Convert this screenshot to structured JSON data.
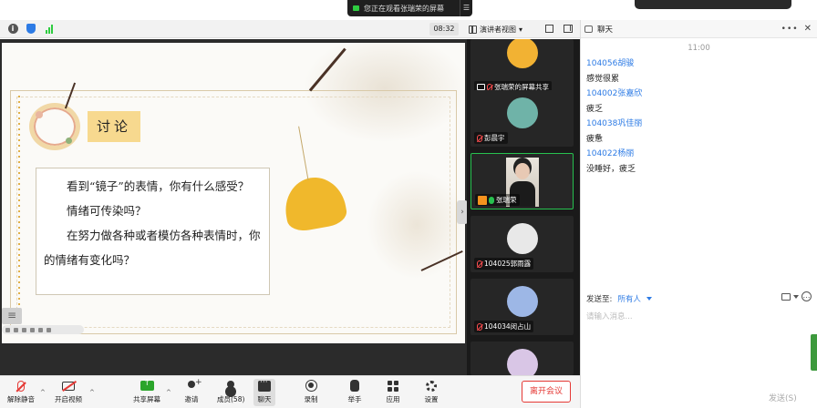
{
  "banner": {
    "text": "您正在观看张瑞荣的屏幕"
  },
  "topbar": {
    "timer": "08:32",
    "view_label": "演讲者视图"
  },
  "slide": {
    "title": "讨论",
    "paragraph1": "看到“镜子”的表情，你有什么感受？",
    "paragraph2": "情绪可传染吗？",
    "paragraph3": "在努力做各种或者模仿各种表情时，你的情绪有变化吗？"
  },
  "gallery": {
    "tiles": [
      {
        "name": "张瑞荣的屏幕共享",
        "avatar_color": "#f2b233"
      },
      {
        "name": "彭晨宇",
        "avatar_color": "#6fb3a8"
      },
      {
        "name": "张瑞荣"
      },
      {
        "name": "104025郭雨露",
        "avatar_color": "#e8e8e8"
      },
      {
        "name": "104034闵占山",
        "avatar_color": "#9db7e6"
      },
      {
        "name": "",
        "avatar_color": "#d9c6e6"
      }
    ]
  },
  "chat": {
    "title": "聊天",
    "time": "11:00",
    "messages": [
      {
        "sender": "104056胡骏",
        "text": "感觉很累"
      },
      {
        "sender": "104002张嘉欣",
        "text": "疲乏"
      },
      {
        "sender": "104038巩佳丽",
        "text": "疲惫"
      },
      {
        "sender": "104022杨丽",
        "text": "没睡好，疲乏"
      }
    ],
    "send_to_label": "发送至:",
    "send_to_value": "所有人",
    "input_placeholder": "请输入消息...",
    "send_label": "发送(S)"
  },
  "toolbar": {
    "unmute": "解除静音",
    "video": "开启视频",
    "share": "共享屏幕",
    "invite": "邀请",
    "members": "成员(58)",
    "chat": "聊天",
    "record": "录制",
    "raise_hand": "举手",
    "apps": "应用",
    "settings": "设置",
    "leave": "离开会议"
  },
  "colors": {
    "accent_blue": "#2d7be5",
    "leave_red": "#e53935",
    "active_green": "#27c14f"
  }
}
